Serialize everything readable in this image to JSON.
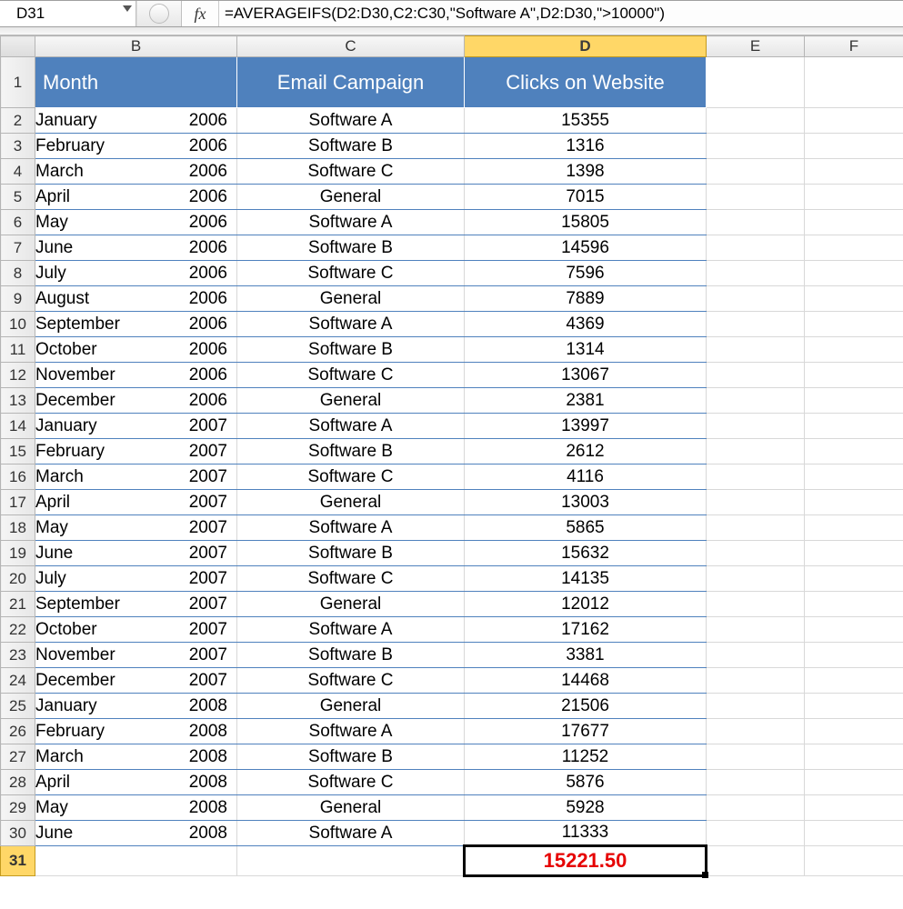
{
  "nameBox": "D31",
  "fxLabel": "fx",
  "formula": "=AVERAGEIFS(D2:D30,C2:C30,\"Software A\",D2:D30,\">10000\")",
  "columns": [
    "B",
    "C",
    "D",
    "E",
    "F"
  ],
  "selectedColumn": "D",
  "selectedRow": 31,
  "headers": {
    "B": "Month",
    "C": "Email Campaign",
    "D": "Clicks on Website"
  },
  "rows": [
    {
      "n": 2,
      "month": "January",
      "year": "2006",
      "camp": "Software A",
      "clicks": "15355"
    },
    {
      "n": 3,
      "month": "February",
      "year": "2006",
      "camp": "Software B",
      "clicks": "1316"
    },
    {
      "n": 4,
      "month": "March",
      "year": "2006",
      "camp": "Software C",
      "clicks": "1398"
    },
    {
      "n": 5,
      "month": "April",
      "year": "2006",
      "camp": "General",
      "clicks": "7015"
    },
    {
      "n": 6,
      "month": "May",
      "year": "2006",
      "camp": "Software A",
      "clicks": "15805"
    },
    {
      "n": 7,
      "month": "June",
      "year": "2006",
      "camp": "Software B",
      "clicks": "14596"
    },
    {
      "n": 8,
      "month": "July",
      "year": "2006",
      "camp": "Software C",
      "clicks": "7596"
    },
    {
      "n": 9,
      "month": "August",
      "year": "2006",
      "camp": "General",
      "clicks": "7889"
    },
    {
      "n": 10,
      "month": "September",
      "year": "2006",
      "camp": "Software A",
      "clicks": "4369"
    },
    {
      "n": 11,
      "month": "October",
      "year": "2006",
      "camp": "Software B",
      "clicks": "1314"
    },
    {
      "n": 12,
      "month": "November",
      "year": "2006",
      "camp": "Software C",
      "clicks": "13067"
    },
    {
      "n": 13,
      "month": "December",
      "year": "2006",
      "camp": "General",
      "clicks": "2381"
    },
    {
      "n": 14,
      "month": "January",
      "year": "2007",
      "camp": "Software A",
      "clicks": "13997"
    },
    {
      "n": 15,
      "month": "February",
      "year": "2007",
      "camp": "Software B",
      "clicks": "2612"
    },
    {
      "n": 16,
      "month": "March",
      "year": "2007",
      "camp": "Software C",
      "clicks": "4116"
    },
    {
      "n": 17,
      "month": "April",
      "year": "2007",
      "camp": "General",
      "clicks": "13003"
    },
    {
      "n": 18,
      "month": "May",
      "year": "2007",
      "camp": "Software A",
      "clicks": "5865"
    },
    {
      "n": 19,
      "month": "June",
      "year": "2007",
      "camp": "Software B",
      "clicks": "15632"
    },
    {
      "n": 20,
      "month": "July",
      "year": "2007",
      "camp": "Software C",
      "clicks": "14135"
    },
    {
      "n": 21,
      "month": "September",
      "year": "2007",
      "camp": "General",
      "clicks": "12012"
    },
    {
      "n": 22,
      "month": "October",
      "year": "2007",
      "camp": "Software A",
      "clicks": "17162"
    },
    {
      "n": 23,
      "month": "November",
      "year": "2007",
      "camp": "Software B",
      "clicks": "3381"
    },
    {
      "n": 24,
      "month": "December",
      "year": "2007",
      "camp": "Software C",
      "clicks": "14468"
    },
    {
      "n": 25,
      "month": "January",
      "year": "2008",
      "camp": "General",
      "clicks": "21506"
    },
    {
      "n": 26,
      "month": "February",
      "year": "2008",
      "camp": "Software A",
      "clicks": "17677"
    },
    {
      "n": 27,
      "month": "March",
      "year": "2008",
      "camp": "Software B",
      "clicks": "11252"
    },
    {
      "n": 28,
      "month": "April",
      "year": "2008",
      "camp": "Software C",
      "clicks": "5876"
    },
    {
      "n": 29,
      "month": "May",
      "year": "2008",
      "camp": "General",
      "clicks": "5928"
    },
    {
      "n": 30,
      "month": "June",
      "year": "2008",
      "camp": "Software A",
      "clicks": "11333"
    }
  ],
  "result": "15221.50"
}
